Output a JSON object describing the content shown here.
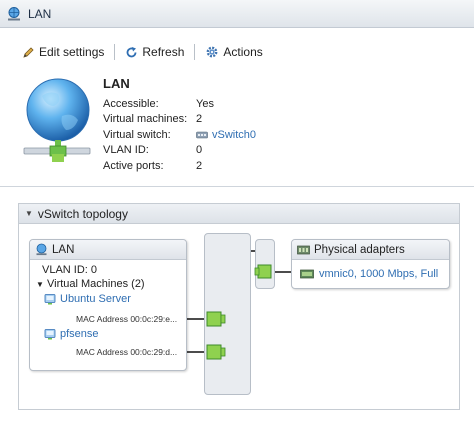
{
  "window": {
    "title": "LAN"
  },
  "toolbar": {
    "edit_label": "Edit settings",
    "refresh_label": "Refresh",
    "actions_label": "Actions"
  },
  "summary": {
    "title": "LAN",
    "props": [
      {
        "key": "Accessible:",
        "value": "Yes"
      },
      {
        "key": "Virtual machines:",
        "value": "2"
      },
      {
        "key": "Virtual switch:",
        "value": "vSwitch0"
      },
      {
        "key": "VLAN ID:",
        "value": "0"
      },
      {
        "key": "Active ports:",
        "value": "2"
      }
    ]
  },
  "topology": {
    "header": "vSwitch topology",
    "portgroup": {
      "name": "LAN",
      "vlan": "VLAN ID: 0",
      "vms_label": "Virtual Machines (2)",
      "vms": [
        {
          "name": "Ubuntu Server",
          "mac": "MAC Address 00:0c:29:e..."
        },
        {
          "name": "pfsense",
          "mac": "MAC Address 00:0c:29:d..."
        }
      ]
    },
    "physical": {
      "label": "Physical adapters",
      "nic": "vmnic0, 1000 Mbps, Full"
    }
  },
  "colors": {
    "link": "#2f6eb2",
    "port_green": "#8fd14f",
    "title_bg": "#dfe4ea"
  }
}
